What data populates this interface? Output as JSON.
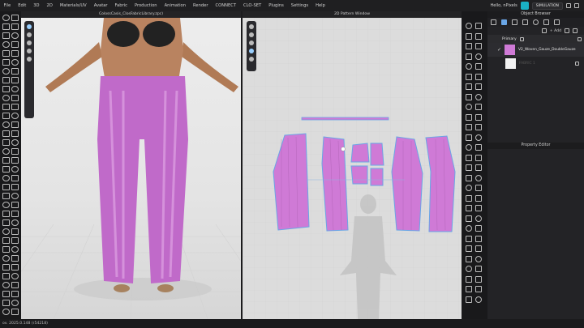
{
  "menu": [
    "File",
    "Edit",
    "3D",
    "2D",
    "Materials/UV",
    "Avatar",
    "Fabric",
    "Production",
    "Animation",
    "Render",
    "CONNECT",
    "CLO-SET",
    "Plugins",
    "Settings",
    "Help"
  ],
  "menu_right": {
    "greeting": "Hello, nPixels",
    "mode": "SIMULATION"
  },
  "viewport3d": {
    "title": "ColossCasis_ClosFabricLibrary.zpc)"
  },
  "viewport2d": {
    "title": "2D Pattern Window"
  },
  "object_browser": {
    "title": "Object Browser",
    "add_label": "+ Add",
    "group_label": "Primary",
    "fabrics": [
      {
        "name": "V2_Woven_Gauze_DoubleGauze",
        "color": "#cf7ad6"
      },
      {
        "name": "FABRIC 1",
        "color": "#f2f2f2"
      }
    ]
  },
  "property_editor": {
    "title": "Property Editor"
  },
  "status": {
    "text": "ov. 2025.0.148 (r54218)"
  },
  "colors": {
    "garment": "#c06ac9",
    "pattern": "#cf7ad6",
    "outline": "#6aa6e6"
  }
}
